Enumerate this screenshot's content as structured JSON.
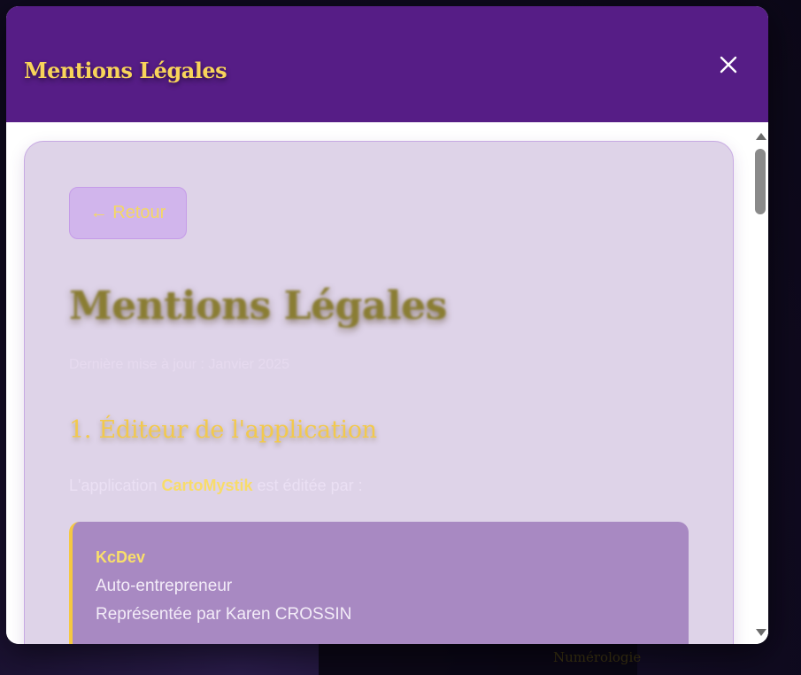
{
  "modal": {
    "title": "Mentions Légales",
    "close_icon": "close-icon"
  },
  "content": {
    "back_button_label": "← Retour",
    "page_title": "Mentions Légales",
    "last_updated": "Dernière mise à jour : Janvier 2025",
    "section1_title": "1. Éditeur de l'application",
    "intro_prefix": "L'application ",
    "intro_brand": "CartoMystik",
    "intro_suffix": " est éditée par :",
    "publisher": {
      "name": "KcDev",
      "status": "Auto-entrepreneur",
      "represented_by": "Représentée par Karen CROSSIN"
    }
  },
  "background": {
    "partial_text": "Numérologie"
  },
  "colors": {
    "header": "#561d86",
    "accent_gold": "#f8d45a",
    "card_bg": "#ded3e8",
    "info_box_bg": "#a889c2"
  }
}
